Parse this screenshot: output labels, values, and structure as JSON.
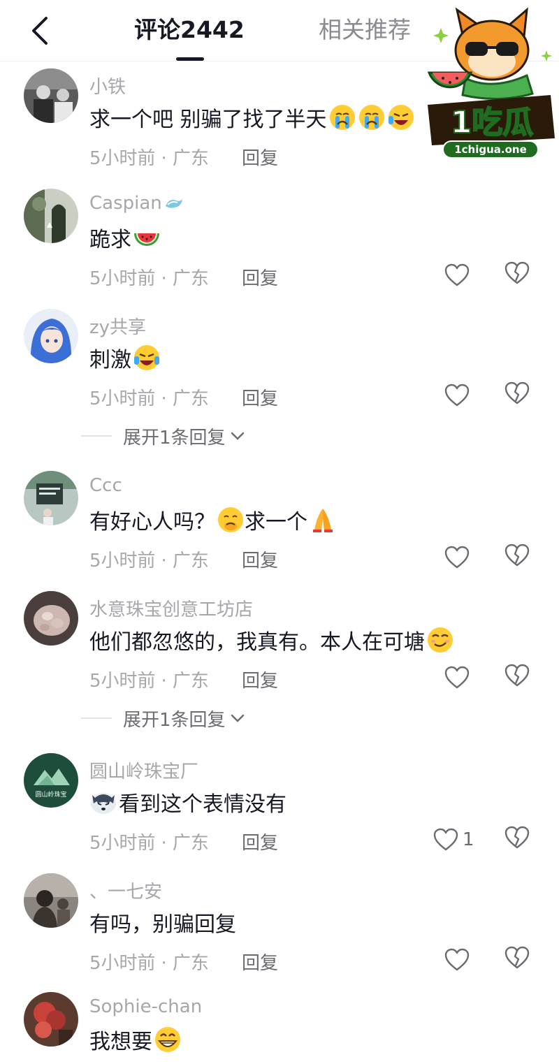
{
  "header": {
    "tab_comments": "评论2442",
    "tab_related": "相关推荐"
  },
  "watermark": {
    "brand": "1吃瓜",
    "domain": "1chigua.one"
  },
  "comments": [
    {
      "user": "小铁",
      "text": "求一个吧 别骗了找了半天",
      "emojis": [
        "crying-emoji",
        "crying-emoji",
        "laugh-cry-emoji"
      ],
      "time": "5小时前",
      "location": "广东",
      "reply_label": "回复",
      "like_count": ""
    },
    {
      "user": "Caspian",
      "user_badge": "wave-badge-icon",
      "text": "跪求",
      "emojis": [
        "watermelon-emoji"
      ],
      "time": "5小时前",
      "location": "广东",
      "reply_label": "回复",
      "like_count": ""
    },
    {
      "user": "zy共享",
      "text": "刺激",
      "emojis": [
        "laugh-cry-emoji"
      ],
      "time": "5小时前",
      "location": "广东",
      "reply_label": "回复",
      "like_count": "",
      "expand_label": "展开1条回复"
    },
    {
      "user": "Ccc",
      "text": "有好心人吗？",
      "text2": "求一个",
      "emojis": [
        "shy-face-emoji",
        "pray-emoji"
      ],
      "time": "5小时前",
      "location": "广东",
      "reply_label": "回复",
      "like_count": ""
    },
    {
      "user": "水意珠宝创意工坊店",
      "text": "他们都忽悠的，我真有。本人在可塘",
      "emojis": [
        "smirk-emoji"
      ],
      "time": "5小时前",
      "location": "广东",
      "reply_label": "回复",
      "like_count": "",
      "expand_label": "展开1条回复"
    },
    {
      "user": "圆山岭珠宝厂",
      "avatar_text": "圆山岭珠宝",
      "text": "看到这个表情没有",
      "emojis": [
        "dog-face-emoji"
      ],
      "time": "5小时前",
      "location": "广东",
      "reply_label": "回复",
      "like_count": "1"
    },
    {
      "user": "、一七安",
      "text": "有吗，别骗回复",
      "emojis": [],
      "time": "5小时前",
      "location": "广东",
      "reply_label": "回复",
      "like_count": ""
    },
    {
      "user": "Sophie-chan",
      "text": "我想要",
      "emojis": [
        "grin-emoji"
      ],
      "time": "",
      "location": "",
      "reply_label": "",
      "like_count": ""
    }
  ],
  "meta_separator": "·"
}
